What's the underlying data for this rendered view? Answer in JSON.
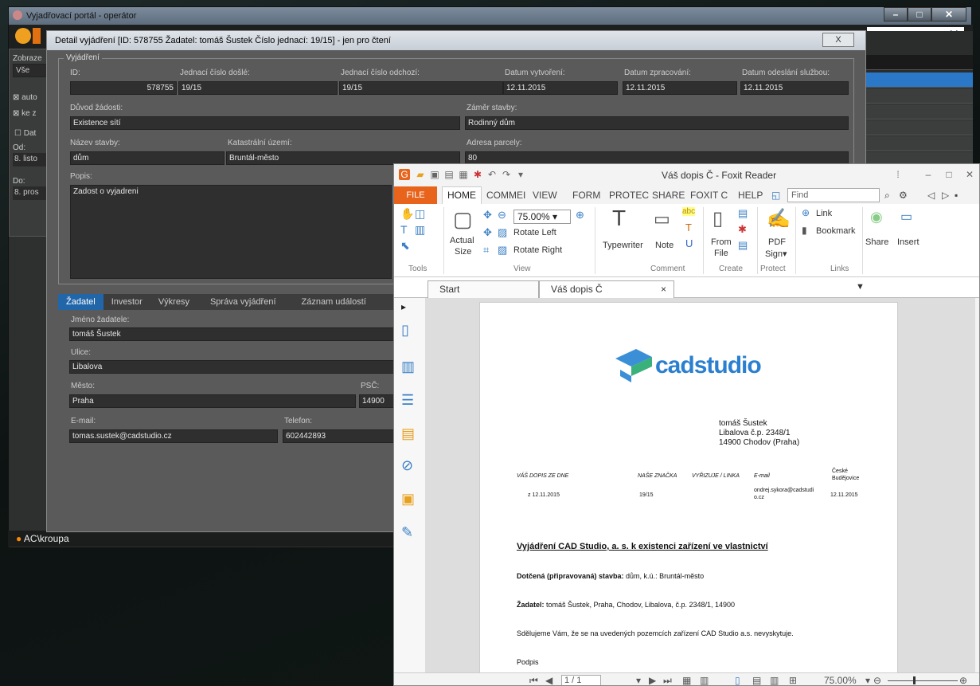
{
  "main_window": {
    "title": "Vyjadřovací portál - operátor",
    "user": "AC\\kroupa"
  },
  "left_panel": {
    "zobrazit_label": "Zobraze",
    "zobrazit_value": "Vše",
    "chk1": "auto",
    "chk2": "ke z",
    "chk3": "Dat",
    "od_label": "Od:",
    "od_value": "8. listo",
    "do_label": "Do:",
    "do_value": "8. pros"
  },
  "dialog": {
    "title": "Detail vyjádření [ID: 578755  Žadatel: tomáš Šustek  Číslo jednací: 19/15] - jen pro čtení",
    "close": "X",
    "group": "Vyjádření",
    "labels": {
      "id": "ID:",
      "jc_dosle": "Jednací číslo došlé:",
      "jc_odchozi": "Jednací číslo odchozí:",
      "dat_vytvoreni": "Datum vytvoření:",
      "dat_zpracovani": "Datum zpracování:",
      "dat_odeslani": "Datum odeslání službou:",
      "duvod": "Důvod žádosti:",
      "zamer": "Záměr stavby:",
      "nazev": "Název stavby:",
      "katastr": "Katastrální území:",
      "adresa": "Adresa parcely:",
      "popis": "Popis:"
    },
    "values": {
      "id": "578755",
      "jc_dosle": "19/15",
      "jc_odchozi": "19/15",
      "dat_vytvoreni": "12.11.2015",
      "dat_zpracovani": "12.11.2015",
      "dat_odeslani": "12.11.2015",
      "duvod": "Existence sítí",
      "zamer": "Rodinný dům",
      "nazev": "dům",
      "katastr": "Bruntál-město",
      "adresa": "80",
      "popis": "Zadost o vyjadreni"
    },
    "tabs": [
      "Žadatel",
      "Investor",
      "Výkresy",
      "Správa vyjádření",
      "Záznam událostí"
    ],
    "zadatel": {
      "jmeno_label": "Jméno žadatele:",
      "jmeno": "tomáš Šustek",
      "ulice_label": "Ulice:",
      "ulice": "Libalova",
      "mesto_label": "Město:",
      "mesto": "Praha",
      "psc_label": "PSČ:",
      "psc": "14900",
      "email_label": "E-mail:",
      "email": "tomas.sustek@cadstudio.cz",
      "telefon_label": "Telefon:",
      "telefon": "602442893"
    }
  },
  "foxit": {
    "title": "Váš dopis Č - Foxit Reader",
    "menu": {
      "file": "FILE",
      "home": "HOME",
      "comment": "COMMEI",
      "view": "VIEW",
      "form": "FORM",
      "protect": "PROTEC",
      "share": "SHARE",
      "foxit": "FOXIT C",
      "help": "HELP"
    },
    "find_placeholder": "Find",
    "ribbon": {
      "zoom": "75.00%",
      "rotate_left": "Rotate Left",
      "rotate_right": "Rotate Right",
      "actual": "Actual",
      "size": "Size",
      "typewriter": "Typewriter",
      "note": "Note",
      "from": "From",
      "file": "File",
      "pdf": "PDF",
      "sign": "Sign",
      "link": "Link",
      "bookmark": "Bookmark",
      "share": "Share",
      "insert": "Insert"
    },
    "groups": {
      "tools": "Tools",
      "view": "View",
      "comment": "Comment",
      "create": "Create",
      "protect": "Protect",
      "links": "Links"
    },
    "tabs": {
      "start": "Start",
      "doc": "Váš dopis Č"
    },
    "status": {
      "page": "1 / 1",
      "zoom": "75.00%"
    }
  },
  "letter": {
    "logo": "cadstudio",
    "addr1": "tomáš Šustek",
    "addr2": "Libalova č.p. 2348/1",
    "addr3": "14900 Chodov (Praha)",
    "h_dopis": "VÁŠ DOPIS ZE DNE",
    "h_znacka": "NAŠE ZNAČKA",
    "h_vyrizuje": "VYŘIZUJE / LINKA",
    "h_email": "E-mail",
    "h_mesto1": "České",
    "h_mesto2": "Budějovice",
    "v_dopis": "z 12.11.2015",
    "v_znacka": "19/15",
    "v_email1": "ondrej.sykora@cadstudi",
    "v_email2": "o.cz",
    "v_datum": "12.11.2015",
    "heading": "Vyjádření CAD Studio, a. s. k existenci zařízení ve vlastnictví",
    "l1b": "Dotčená (připravovaná) stavba:",
    "l1": " dům, k.ú.: Bruntál-město",
    "l2b": "Žadatel:",
    "l2": " tomáš Šustek, Praha, Chodov, Libalova, č.p. 2348/1, 14900",
    "l3": "Sdělujeme Vám, že se na uvedených pozemcích zařízení CAD Studio a.s. nevyskytuje.",
    "l4": "Podpis"
  },
  "colors": {
    "accent": "#2266aa",
    "foxit_orange": "#e8641c",
    "cad_blue": "#3a8fd6",
    "cad_green": "#3ab07a"
  }
}
